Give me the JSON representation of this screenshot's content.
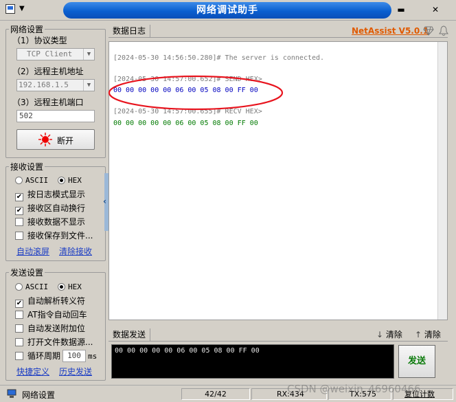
{
  "window": {
    "title": "网络调试助手",
    "sysmenu_icon": "network-app-icon",
    "minimize_symbol": "▬",
    "close_symbol": "✕"
  },
  "net_settings": {
    "legend": "网络设置",
    "protocol_label": "（1）协议类型",
    "protocol_value": "TCP Client",
    "host_label": "（2）远程主机地址",
    "host_value": "192.168.1.5",
    "port_label": "（3）远程主机端口",
    "port_value": "502",
    "disconnect_label": "断开"
  },
  "recv_settings": {
    "legend": "接收设置",
    "ascii_label": "ASCII",
    "hex_label": "HEX",
    "hex_selected": true,
    "options": [
      {
        "label": "按日志模式显示",
        "checked": true
      },
      {
        "label": "接收区自动换行",
        "checked": true
      },
      {
        "label": "接收数据不显示",
        "checked": false
      },
      {
        "label": "接收保存到文件...",
        "checked": false
      }
    ],
    "auto_scroll_link": "自动滚屏",
    "clear_recv_link": "清除接收"
  },
  "send_settings": {
    "legend": "发送设置",
    "ascii_label": "ASCII",
    "hex_label": "HEX",
    "hex_selected": true,
    "options": [
      {
        "label": "自动解析转义符",
        "checked": true
      },
      {
        "label": "AT指令自动回车",
        "checked": false
      },
      {
        "label": "自动发送附加位",
        "checked": false
      },
      {
        "label": "打开文件数据源...",
        "checked": false
      },
      {
        "label": "循环周期",
        "checked": false
      }
    ],
    "cycle_value": "100",
    "cycle_unit": "ms",
    "shortcut_link": "快捷定义",
    "history_link": "历史发送"
  },
  "log": {
    "tab_label": "数据日志",
    "brand": "NetAssist V5.0.1",
    "lines": [
      {
        "text": "[2024-05-30 14:56:50.280]# The server is connected.",
        "kind": "meta"
      },
      {
        "text": "[2024-05-30 14:57:00.652]# SEND HEX>",
        "kind": "meta"
      },
      {
        "text": "00 00 00 00 00 06 00 05 08 00 FF 00",
        "kind": "send"
      },
      {
        "text": "[2024-05-30 14:57:00.655]# RECV HEX>",
        "kind": "meta"
      },
      {
        "text": "00 00 00 00 00 06 00 05 08 00 FF 00",
        "kind": "recv"
      }
    ],
    "highlight_color": "#e8141e"
  },
  "send_area": {
    "tab_label": "数据发送",
    "clear_label_1": "清除",
    "clear_label_2": "清除",
    "content": "00 00 00 00 00 06 00 05 08 00 FF 00",
    "send_button": "发送"
  },
  "statusbar": {
    "label": "网络设置",
    "counter": "42/42",
    "rx": "RX:434",
    "tx": "TX:575",
    "reset": "复位计数",
    "watermark": "CSDN @weixin_46960466"
  }
}
